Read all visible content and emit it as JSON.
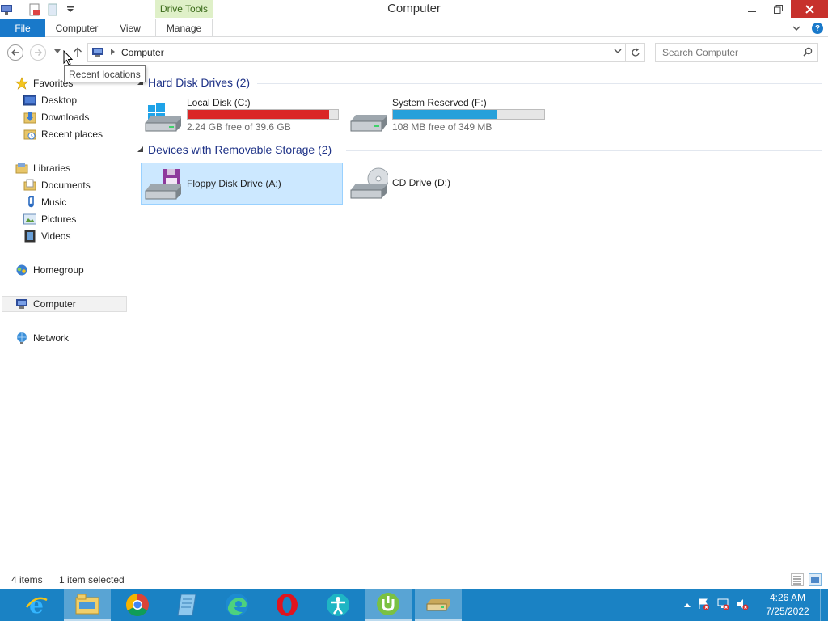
{
  "window": {
    "title": "Computer",
    "context_tab": "Drive Tools"
  },
  "ribbon": {
    "tabs": [
      "File",
      "Computer",
      "View",
      "Manage"
    ]
  },
  "address": {
    "path": "Computer",
    "search_placeholder": "Search Computer"
  },
  "tooltip": "Recent locations",
  "navpane": {
    "favorites": "Favorites",
    "favorite_items": [
      "Desktop",
      "Downloads",
      "Recent places"
    ],
    "libraries": "Libraries",
    "library_items": [
      "Documents",
      "Music",
      "Pictures",
      "Videos"
    ],
    "homegroup": "Homegroup",
    "computer": "Computer",
    "network": "Network"
  },
  "groups": [
    {
      "title": "Hard Disk Drives (2)",
      "drives": [
        {
          "name": "Local Disk (C:)",
          "free_text": "2.24 GB free of 39.6 GB",
          "used_fraction": 0.94,
          "bar_color": "#da2626",
          "icon": "windows-drive-icon"
        },
        {
          "name": "System Reserved (F:)",
          "free_text": "108 MB free of 349 MB",
          "used_fraction": 0.69,
          "bar_color": "#26a0da",
          "icon": "hard-drive-icon"
        }
      ]
    },
    {
      "title": "Devices with Removable Storage (2)",
      "drives": [
        {
          "name": "Floppy Disk Drive (A:)",
          "icon": "floppy-drive-icon",
          "selected": true
        },
        {
          "name": "CD Drive (D:)",
          "icon": "cd-drive-icon",
          "selected": false
        }
      ]
    }
  ],
  "status": {
    "item_count": "4 items",
    "selection": "1 item selected"
  },
  "taskbar": {
    "apps": [
      "internet-explorer-icon",
      "file-explorer-icon",
      "chrome-icon",
      "notepad-icon",
      "edge-icon",
      "opera-icon",
      "accessibility-icon",
      "utorrent-icon",
      "drive-icon"
    ],
    "time": "4:26 AM",
    "date": "7/25/2022"
  },
  "colors": {
    "accent": "#1979ca",
    "taskbar": "#1a82c4",
    "selection": "#cce8ff",
    "group_title": "#1e3287"
  }
}
